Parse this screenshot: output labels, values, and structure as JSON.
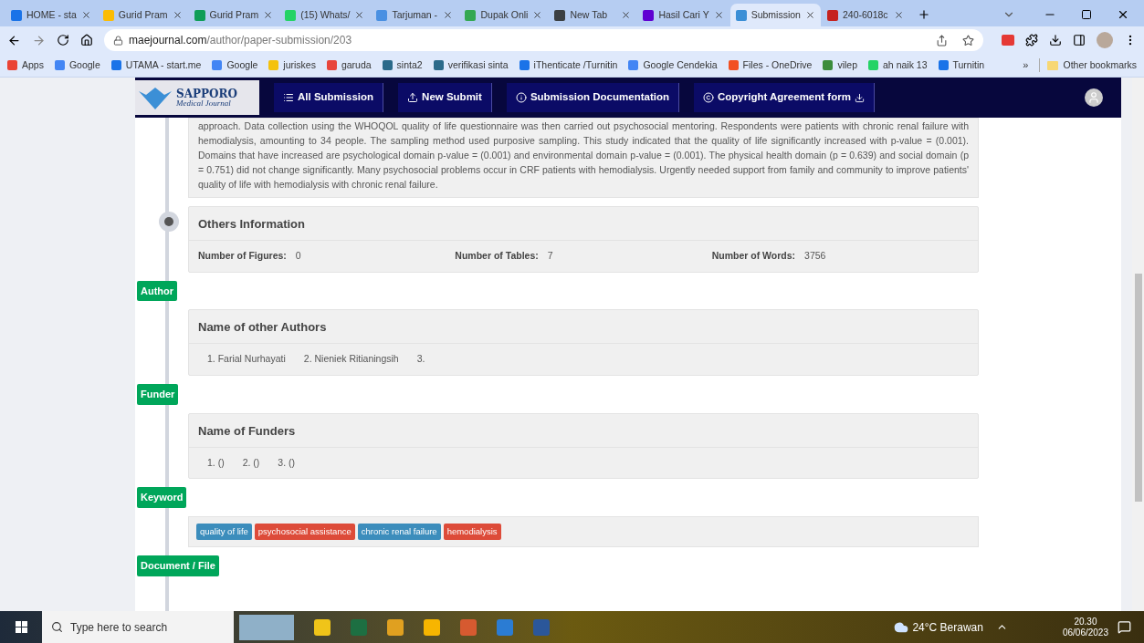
{
  "browser": {
    "tabs": [
      {
        "title": "HOME - sta",
        "color": "#1a73e8",
        "selected": false
      },
      {
        "title": "Gurid Pram",
        "color": "#fbbc04",
        "selected": false
      },
      {
        "title": "Gurid Pram",
        "color": "#0f9d58",
        "selected": false
      },
      {
        "title": "(15) Whats/",
        "color": "#25d366",
        "selected": false
      },
      {
        "title": "Tarjuman - ",
        "color": "#4a90e2",
        "selected": false
      },
      {
        "title": "Dupak Onli",
        "color": "#34a853",
        "selected": false
      },
      {
        "title": "New Tab",
        "color": "#3c4043",
        "selected": false
      },
      {
        "title": "Hasil Cari Y",
        "color": "#6001d2",
        "selected": false
      },
      {
        "title": "Submission",
        "color": "#3b8fd6",
        "selected": true
      },
      {
        "title": "240-6018c",
        "color": "#c5221f",
        "selected": false
      }
    ],
    "url_domain": "maejournal.com",
    "url_path": "/author/paper-submission/203",
    "bookmarks": [
      {
        "label": "Apps",
        "color": "#ea4335"
      },
      {
        "label": "Google",
        "color": "#4285f4"
      },
      {
        "label": "UTAMA - start.me",
        "color": "#1a73e8"
      },
      {
        "label": "Google",
        "color": "#4285f4"
      },
      {
        "label": "juriskes",
        "color": "#f4c20d"
      },
      {
        "label": "garuda",
        "color": "#e8453c"
      },
      {
        "label": "sinta2",
        "color": "#2b6a8a"
      },
      {
        "label": "verifikasi sinta",
        "color": "#2b6a8a"
      },
      {
        "label": "iThenticate /Turnitin",
        "color": "#1a73e8"
      },
      {
        "label": "Google Cendekia",
        "color": "#4285f4"
      },
      {
        "label": "Files - OneDrive",
        "color": "#f25022"
      },
      {
        "label": "vilep",
        "color": "#3c8d3c"
      },
      {
        "label": "ah naik 13",
        "color": "#25d366"
      },
      {
        "label": "Turnitin",
        "color": "#1a73e8"
      }
    ],
    "overflow": "»",
    "other_bookmarks": "Other bookmarks"
  },
  "site": {
    "logo_title": "SAPPORO",
    "logo_subtitle": "Medical Journal",
    "nav": [
      {
        "label": "All Submission"
      },
      {
        "label": "New Submit"
      },
      {
        "label": "Submission Documentation"
      },
      {
        "label": "Copyright Agreement form"
      }
    ]
  },
  "abstract_text": "approach. Data collection using the WHOQOL quality of life questionnaire was then carried out psychosocial mentoring. Respondents were patients with chronic renal failure with hemodialysis, amounting to 34 people. The sampling method used purposive sampling. This study indicated that the quality of life significantly increased with p-value = (0.001). Domains that have increased are psychological domain p-value = (0.001) and environmental domain p-value = (0.001). The physical health domain (p = 0.639) and social domain (p = 0.751) did not change significantly. Many psychosocial problems occur in CRF patients with hemodialysis. Urgently needed support from family and community to improve patients' quality of life with hemodialysis with chronic renal failure.",
  "others_information": {
    "title": "Others Information",
    "fields": [
      {
        "label": "Number of Figures:",
        "value": "0"
      },
      {
        "label": "Number of Tables:",
        "value": "7"
      },
      {
        "label": "Number of Words:",
        "value": "3756"
      }
    ]
  },
  "author": {
    "label": "Author",
    "title": "Name of other Authors",
    "items": [
      "1. Farial Nurhayati",
      "2. Nieniek Ritianingsih",
      "3."
    ]
  },
  "funder": {
    "label": "Funder",
    "title": "Name of Funders",
    "items": [
      "1. ()",
      "2. ()",
      "3. ()"
    ]
  },
  "keyword": {
    "label": "Keyword",
    "tags": [
      {
        "text": "quality of life",
        "color": "#3c8dbc"
      },
      {
        "text": "psychosocial assistance",
        "color": "#dd4b39"
      },
      {
        "text": "chronic renal failure",
        "color": "#3c8dbc"
      },
      {
        "text": "hemodialysis",
        "color": "#dd4b39"
      }
    ]
  },
  "document": {
    "label": "Document / File"
  },
  "taskbar": {
    "search_placeholder": "Type here to search",
    "weather": "24°C Berawan",
    "time": "20.30",
    "date": "06/06/2023"
  }
}
